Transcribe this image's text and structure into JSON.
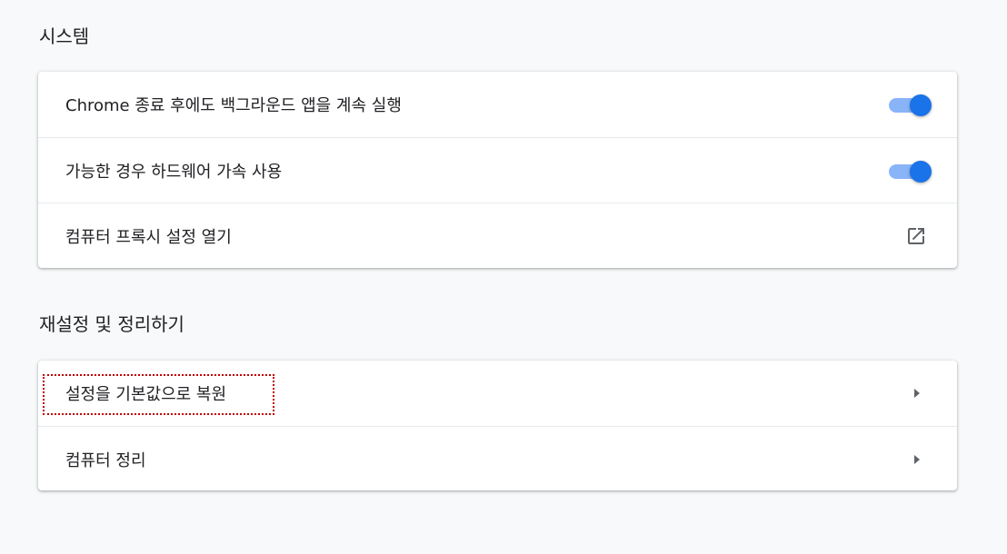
{
  "sections": {
    "system": {
      "title": "시스템",
      "rows": [
        {
          "label": "Chrome 종료 후에도 백그라운드 앱을 계속 실행",
          "control": "toggle",
          "checked": true
        },
        {
          "label": "가능한 경우 하드웨어 가속 사용",
          "control": "toggle",
          "checked": true
        },
        {
          "label": "컴퓨터 프록시 설정 열기",
          "control": "open-in-new-icon"
        }
      ]
    },
    "reset": {
      "title": "재설정 및 정리하기",
      "rows": [
        {
          "label": "설정을 기본값으로 복원",
          "control": "arrow-right-icon",
          "focused": true
        },
        {
          "label": "컴퓨터 정리",
          "control": "arrow-right-icon"
        }
      ]
    }
  },
  "colors": {
    "background": "#f8f9fa",
    "toggle_knob": "#1a73e8",
    "toggle_bar": "#8ab4f8",
    "focus_outline": "#c00000"
  }
}
